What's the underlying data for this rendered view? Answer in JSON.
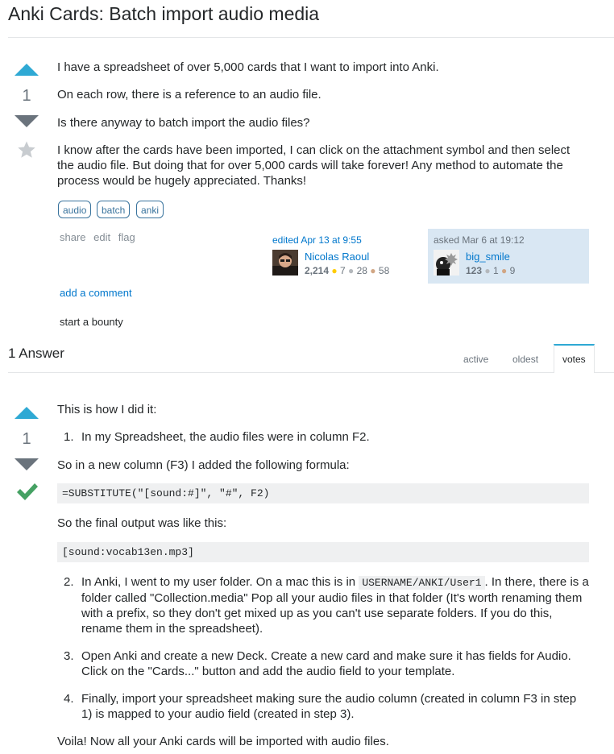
{
  "question": {
    "title": "Anki Cards: Batch import audio media",
    "vote_count": "1",
    "paragraphs": [
      "I have a spreadsheet of over 5,000 cards that I want to import into Anki.",
      "On each row, there is a reference to an audio file.",
      "Is there anyway to batch import the audio files?",
      "I know after the cards have been imported, I can click on the attachment symbol and then select the audio file. But doing that for over 5,000 cards will take forever! Any method to automate the process would be hugely appreciated. Thanks!"
    ],
    "tags": [
      "audio",
      "batch",
      "anki"
    ],
    "menu": {
      "share": "share",
      "edit": "edit",
      "flag": "flag"
    },
    "editor": {
      "action": "edited Apr 13 at 9:55",
      "name": "Nicolas Raoul",
      "rep": "2,214",
      "gold": "7",
      "silver": "28",
      "bronze": "58"
    },
    "asker": {
      "action": "asked Mar 6 at 19:12",
      "name": "big_smile",
      "rep": "123",
      "silver": "1",
      "bronze": "9"
    },
    "add_comment": "add a comment",
    "bounty": "start a bounty",
    "badge_dot": "●"
  },
  "answers_header": {
    "count": "1 Answer",
    "tabs": [
      "active",
      "oldest",
      "votes"
    ],
    "active_tab": "votes"
  },
  "answer": {
    "vote_count": "1",
    "intro": "This is how I did it:",
    "step1_num": "1.",
    "step1": "In my Spreadsheet, the audio files were in column F2.",
    "new_column": "So in a new column (F3) I added the following formula:",
    "formula": "=SUBSTITUTE(\"[sound:#]\", \"#\", F2)",
    "final_output": "So the final output was like this:",
    "output_code": "[sound:vocab13en.mp3]",
    "step2_num": "2.",
    "step2_pre": "In Anki, I went to my user folder. On a mac this is in ",
    "step2_code": "USERNAME/ANKI/User1",
    "step2_post": ". In there, there is a folder called \"Collection.media\" Pop all your audio files in that folder (It's worth renaming them with a prefix, so they don't get mixed up as you can't use separate folders. If you do this, rename them in the spreadsheet).",
    "step3_num": "3.",
    "step3": "Open Anki and create a new Deck. Create a new card and make sure it has fields for Audio. Click on the \"Cards...\" button and add the audio field to your template.",
    "step4_num": "4.",
    "step4": "Finally, import your spreadsheet making sure the audio column (created in column F3 in step 1) is mapped to your audio field (created in step 3).",
    "closing": "Voila! Now all your Anki cards will be imported with audio files."
  }
}
